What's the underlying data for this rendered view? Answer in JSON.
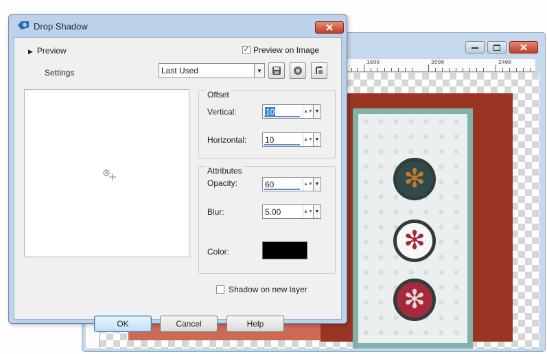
{
  "dialog": {
    "title": "Drop Shadow",
    "preview_toggle": "Preview",
    "preview_on_image_label": "Preview on Image",
    "preview_on_image_checked": true,
    "settings_label": "Settings",
    "settings_value": "Last Used",
    "icons": {
      "save": "save-preset-icon",
      "presets": "presets-icon",
      "reset": "reset-icon",
      "zoom": "zoom-cursor-icon"
    }
  },
  "offset": {
    "title": "Offset",
    "vertical_label": "Vertical:",
    "vertical_value": "10",
    "horizontal_label": "Horizontal:",
    "horizontal_value": "10"
  },
  "attributes": {
    "title": "Attributes",
    "opacity_label": "Opacity:",
    "opacity_value": "60",
    "blur_label": "Blur:",
    "blur_value": "5.00",
    "color_label": "Color:",
    "color_value": "#000000"
  },
  "shadow_on_new_layer_label": "Shadow on new layer",
  "shadow_on_new_layer_checked": false,
  "buttons": {
    "ok": "OK",
    "cancel": "Cancel",
    "help": "Help"
  },
  "background_window": {
    "ruler_labels": [
      "1600",
      "2000",
      "2400"
    ],
    "colors": {
      "paper": "#9a3524",
      "card_border": "#7fb2aa",
      "ornament_dark": "#2f4b4a",
      "ornament_red": "#a42a3b"
    }
  }
}
